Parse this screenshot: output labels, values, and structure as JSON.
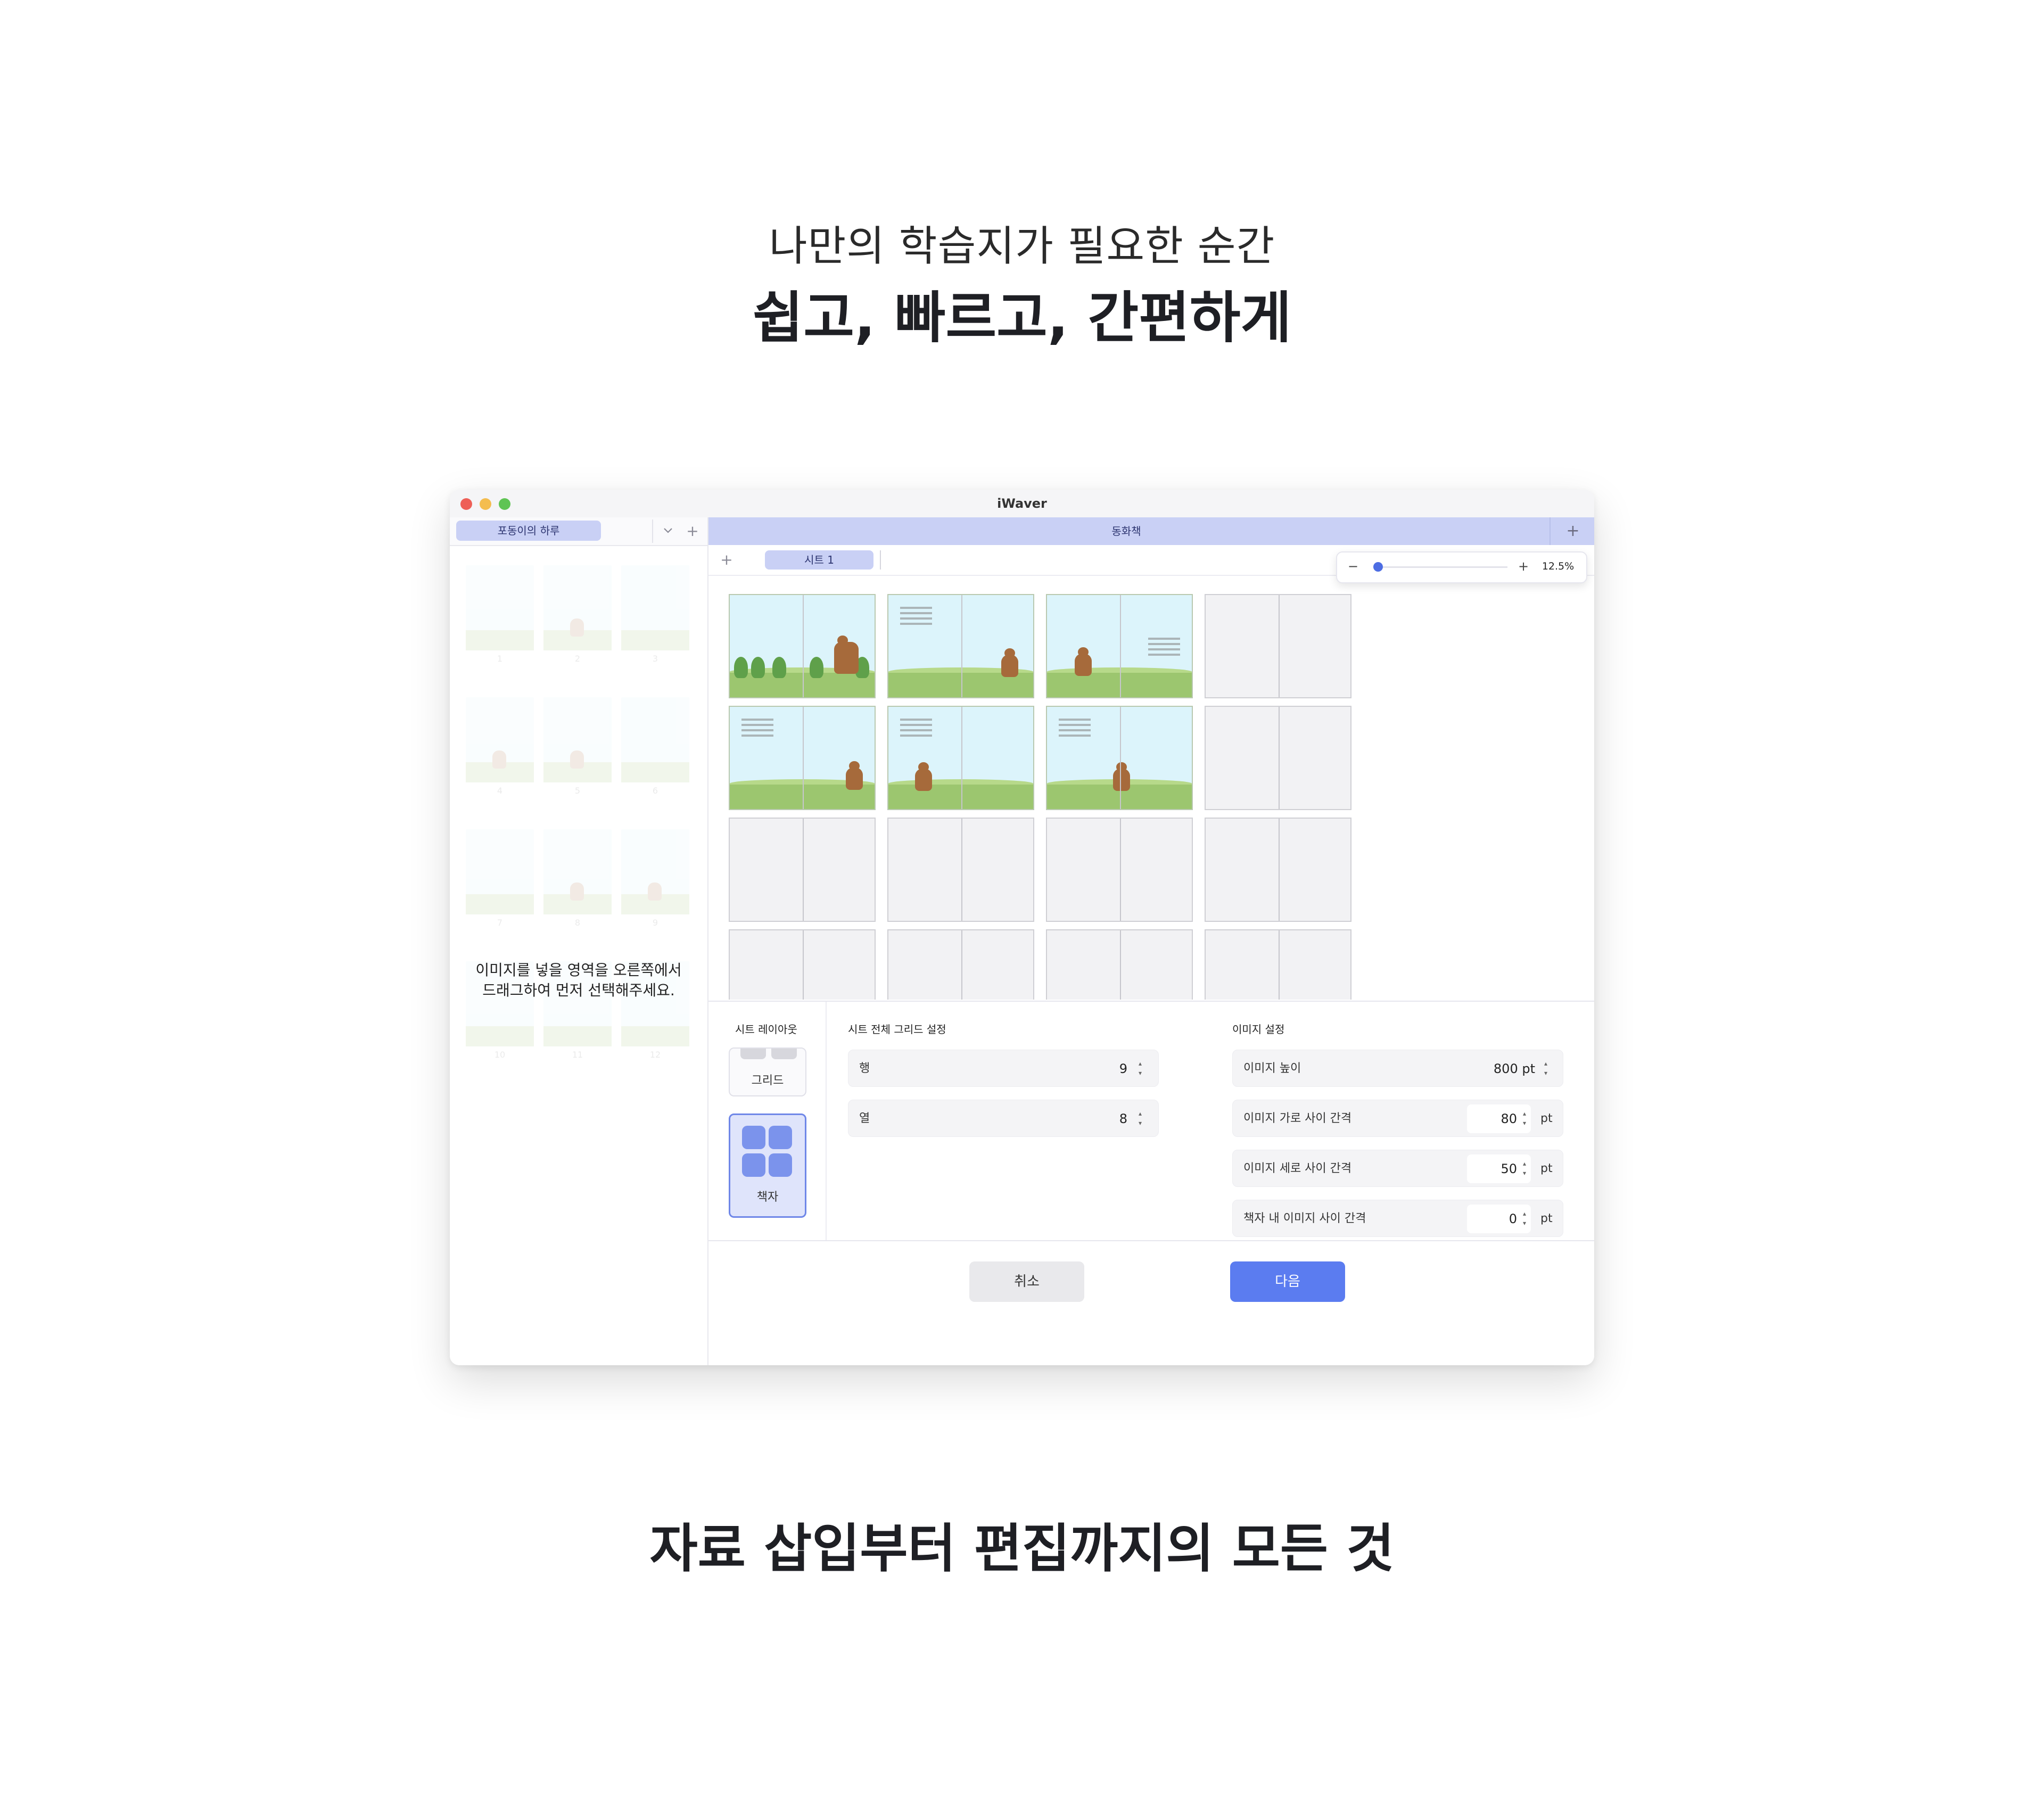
{
  "hero": {
    "subtitle": "나만의 학습지가 필요한 순간",
    "title": "쉽고, 빠르고, 간편하게"
  },
  "footer_title": "자료 삽입부터 편집까지의 모든 것",
  "window": {
    "title": "iWaver",
    "document_tab": "포동이의 하루",
    "sheet_title": "동화책",
    "sheet_tab": "시트 1",
    "empty_hint_line1": "이미지를 넣을 영역을 오른쪽에서",
    "empty_hint_line2": "드래그하여 먼저 선택해주세요.",
    "thumbnail_numbers": [
      "1",
      "2",
      "3",
      "4",
      "5",
      "6",
      "7",
      "8",
      "9",
      "10",
      "11",
      "12"
    ],
    "zoom": {
      "minus": "−",
      "plus": "+",
      "value": "12.5%",
      "level": 0.0
    },
    "sheet_layout": {
      "label": "시트 레이아웃",
      "grid_label": "그리드",
      "book_label": "책자",
      "selected": "책자"
    },
    "grid_settings": {
      "label": "시트 전체 그리드 설정",
      "rows_label": "행",
      "rows_value": "9",
      "cols_label": "열",
      "cols_value": "8"
    },
    "image_settings": {
      "label": "이미지 설정",
      "height_label": "이미지 높이",
      "height_value": "800 pt",
      "hgap_label": "이미지 가로 사이 간격",
      "hgap_value": "80",
      "vgap_label": "이미지 세로 사이 간격",
      "vgap_value": "50",
      "book_gap_label": "책자 내 이미지 사이 간격",
      "book_gap_value": "0",
      "unit": "pt"
    },
    "buttons": {
      "cancel": "취소",
      "next": "다음"
    }
  },
  "icons": {
    "chevron": "chevron-down-icon",
    "add": "plus-icon",
    "stepper": "stepper-icon"
  },
  "colors": {
    "accent": "#5b7cf0",
    "tab_highlight": "#c9d0f5",
    "selected_card": "#dfe4fb"
  }
}
